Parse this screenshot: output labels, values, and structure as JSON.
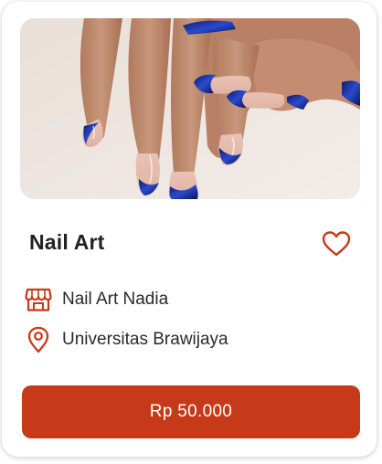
{
  "card": {
    "title": "Nail Art",
    "shop_name": "Nail Art Nadia",
    "location": "Universitas Brawijaya",
    "price_label": "Rp 50.000",
    "icons": {
      "favorite": "heart-outline-icon",
      "shop": "storefront-icon",
      "location": "map-pin-icon"
    },
    "colors": {
      "accent": "#c63a1a",
      "text": "#222222"
    }
  }
}
